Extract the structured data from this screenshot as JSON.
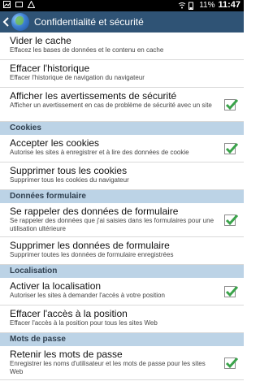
{
  "status": {
    "battery": "11%",
    "time": "11:47"
  },
  "appbar": {
    "title": "Confidentialité et sécurité"
  },
  "sections": [
    {
      "header": null,
      "items": [
        {
          "title": "Vider le cache",
          "subtitle": "Effacez les bases de données et le contenu en cache",
          "checkbox": false
        },
        {
          "title": "Effacer l'historique",
          "subtitle": "Effacer l'historique de navigation du navigateur",
          "checkbox": false
        },
        {
          "title": "Afficher les avertissements de sécurité",
          "subtitle": "Afficher un avertissement en cas de problème de sécurité avec un site",
          "checkbox": true,
          "checked": true
        }
      ]
    },
    {
      "header": "Cookies",
      "items": [
        {
          "title": "Accepter les cookies",
          "subtitle": "Autorise les sites à enregistrer et à lire des données de cookie",
          "checkbox": true,
          "checked": true
        },
        {
          "title": "Supprimer tous les cookies",
          "subtitle": "Supprimer tous les cookies du navigateur",
          "checkbox": false
        }
      ]
    },
    {
      "header": "Données formulaire",
      "items": [
        {
          "title": "Se rappeler des données de formulaire",
          "subtitle": "Se rappeler des données que j'ai saisies dans les formulaires pour une utilisation ultérieure",
          "checkbox": true,
          "checked": true
        },
        {
          "title": "Supprimer les données de formulaire",
          "subtitle": "Supprimer toutes les données de formulaire enregistrées",
          "checkbox": false
        }
      ]
    },
    {
      "header": "Localisation",
      "items": [
        {
          "title": "Activer la localisation",
          "subtitle": "Autoriser les sites à demander l'accès à votre position",
          "checkbox": true,
          "checked": true
        },
        {
          "title": "Effacer l'accès à la position",
          "subtitle": "Effacer l'accès à la position pour tous les sites Web",
          "checkbox": false
        }
      ]
    },
    {
      "header": "Mots de passe",
      "items": [
        {
          "title": "Retenir les mots de passe",
          "subtitle": "Enregistrer les noms d'utilisateur et les mots de passe pour les sites Web",
          "checkbox": true,
          "checked": true
        }
      ]
    }
  ],
  "colors": {
    "appbar": "#2f5375",
    "section_header": "#bcd3e6",
    "check": "#3aa34a"
  },
  "icons": {
    "back": "chevron-left-icon",
    "app": "globe-icon"
  }
}
